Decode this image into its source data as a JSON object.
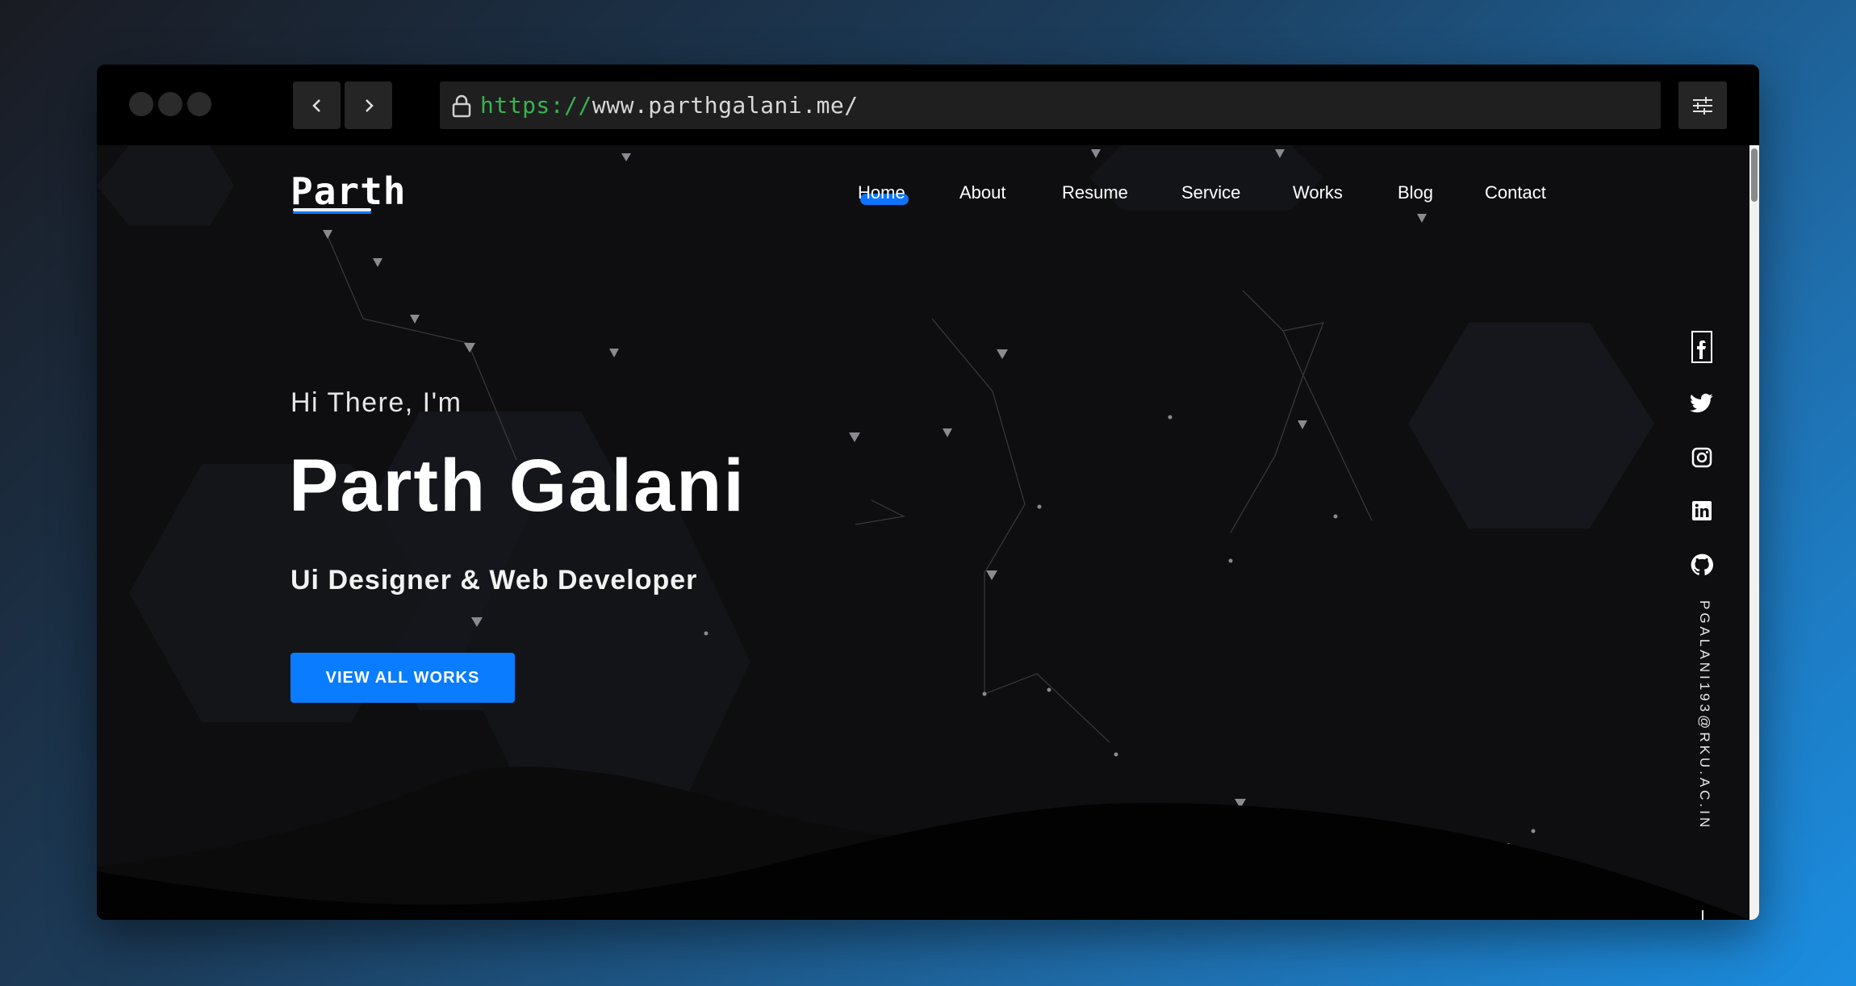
{
  "browser": {
    "url_protocol": "https://",
    "url_host": "www.parthgalani.me/"
  },
  "site": {
    "logo_text": "Parth",
    "nav": [
      {
        "label": "Home",
        "active": true
      },
      {
        "label": "About"
      },
      {
        "label": "Resume"
      },
      {
        "label": "Service"
      },
      {
        "label": "Works"
      },
      {
        "label": "Blog"
      },
      {
        "label": "Contact"
      }
    ],
    "hero": {
      "greeting": "Hi There, I'm",
      "name": "Parth Galani",
      "role": "Ui Designer & Web Developer",
      "cta_label": "VIEW ALL WORKS"
    },
    "social": [
      "facebook-icon",
      "twitter-icon",
      "instagram-icon",
      "linkedin-icon",
      "github-icon"
    ],
    "email": "PGALANI193@RKU.AC.IN"
  },
  "colors": {
    "accent": "#0A7CFF",
    "protocol_green": "#38B24F"
  }
}
